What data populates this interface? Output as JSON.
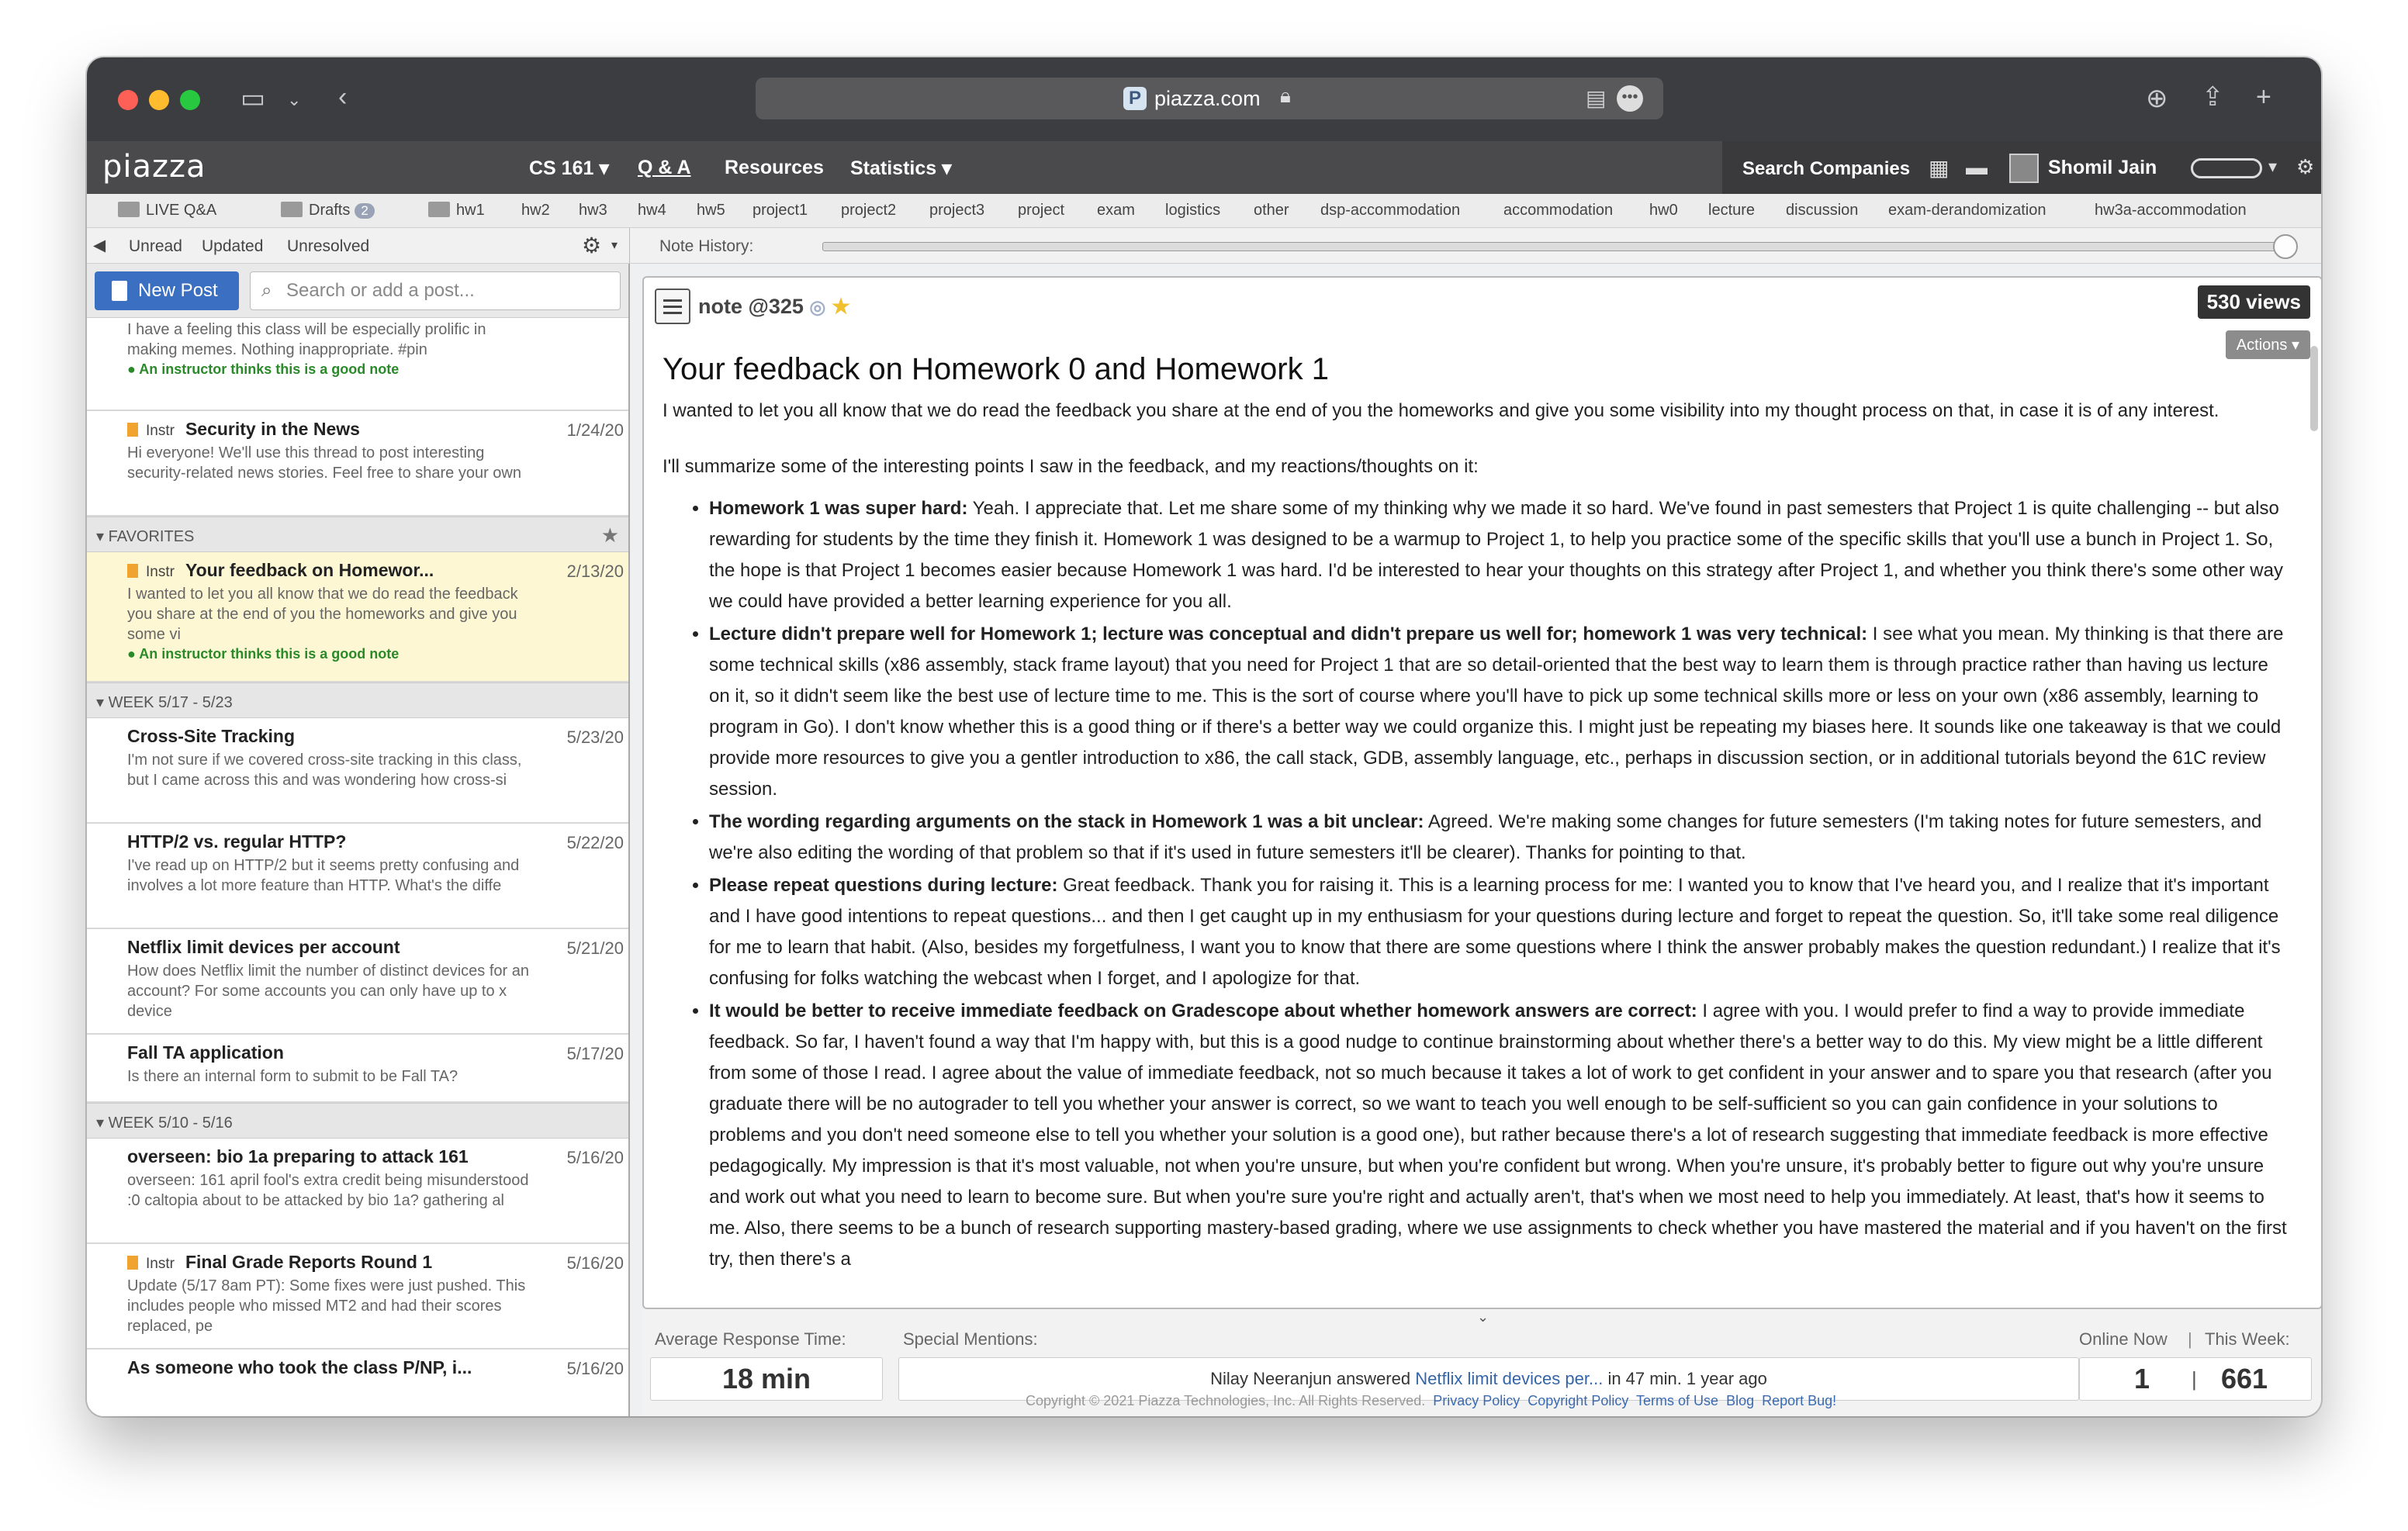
{
  "browser": {
    "host": "piazza.com"
  },
  "nav": {
    "logo": "piazza",
    "course": "CS 161 ▾",
    "qa": "Q & A",
    "resources": "Resources",
    "statistics": "Statistics ▾",
    "search_companies": "Search Companies",
    "user": "Shomil Jain"
  },
  "folders": {
    "live_qa": "LIVE Q&A",
    "drafts": "Drafts",
    "drafts_count": "2",
    "items": [
      "hw1",
      "hw2",
      "hw3",
      "hw4",
      "hw5",
      "project1",
      "project2",
      "project3",
      "project",
      "exam",
      "logistics",
      "other",
      "dsp-accommodation",
      "accommodation",
      "hw0",
      "lecture",
      "discussion",
      "exam-derandomization",
      "hw3a-accommodation"
    ]
  },
  "filters": {
    "unread": "Unread",
    "updated": "Updated",
    "unresolved": "Unresolved"
  },
  "history": {
    "label": "Note History:"
  },
  "sidebar": {
    "new_post": "New Post",
    "search_placeholder": "Search or add a post...",
    "first_snippet": "I have a feeling this class will be especially prolific in making memes. Nothing inappropriate. #pin",
    "good_note": "An instructor thinks this is a good note",
    "instr": "Instr",
    "security": {
      "title": "Security in the News",
      "date": "1/24/20",
      "snippet": "Hi everyone!  We'll use this thread to post interesting security-related news stories. Feel free to share your own"
    },
    "favorites_label": "FAVORITES",
    "feedback": {
      "title": "Your feedback on Homewor...",
      "date": "2/13/20",
      "snippet": "I wanted to let you all know that we do read the feedback you share at the end of you the homeworks and give you some vi"
    },
    "week1_label": "WEEK 5/17 - 5/23",
    "week1_items": [
      {
        "title": "Cross-Site Tracking",
        "date": "5/23/20",
        "snippet": "I'm not sure if we covered cross-site tracking in this class, but I came across this and was wondering how cross-si"
      },
      {
        "title": "HTTP/2 vs. regular HTTP?",
        "date": "5/22/20",
        "snippet": "I've read up on HTTP/2 but it seems pretty confusing and involves a lot more feature than HTTP. What's the diffe"
      },
      {
        "title": "Netflix limit devices per account",
        "date": "5/21/20",
        "snippet": "How does Netflix limit the number of distinct devices for an account? For some accounts you can only have up to x device"
      },
      {
        "title": "Fall TA application",
        "date": "5/17/20",
        "snippet": "Is there an internal form to submit to be Fall TA?"
      }
    ],
    "week2_label": "WEEK 5/10 - 5/16",
    "week2_items": [
      {
        "title": "overseen: bio 1a preparing to attack 161",
        "date": "5/16/20",
        "snippet": "overseen: 161 april fool's extra credit being misunderstood :0 caltopia about to be attacked by bio 1a? gathering al"
      },
      {
        "title": "Final Grade Reports Round 1",
        "date": "5/16/20",
        "snippet": "Update (5/17 8am PT): Some fixes were just pushed. This includes people who missed MT2 and had their scores replaced, pe"
      },
      {
        "title": "As someone who took the class P/NP, i...",
        "date": "5/16/20",
        "snippet": ""
      }
    ]
  },
  "post": {
    "label": "note @325",
    "views": "530 views",
    "actions": "Actions",
    "title": "Your feedback on Homework 0 and Homework 1",
    "intro": "I wanted to let you all know that we do read the feedback you share at the end of you the homeworks and give you some visibility into my thought process on that, in case it is of any interest.",
    "intro2": "I'll summarize some of the interesting points I saw in the feedback, and my reactions/thoughts on it:",
    "points": [
      {
        "bold": "Homework 1 was super hard:",
        "text": " Yeah.  I appreciate that.  Let me share some of my thinking why we made it so hard.  We've found in past semesters that Project 1 is quite challenging -- but also rewarding for students by the time they finish it.  Homework 1 was designed to be a warmup to Project 1, to help you practice some of the specific skills that you'll use a bunch in Project 1.  So, the hope is that Project 1 becomes easier because Homework 1 was hard.  I'd be interested to hear your thoughts on this strategy after Project 1, and whether you think there's some other way we could have provided a better learning experience for you all."
      },
      {
        "bold": "Lecture didn't prepare well for Homework 1; lecture was conceptual and didn't prepare us well for; homework 1 was very technical:",
        "text": " I see what you mean.  My thinking is that there are some technical skills (x86 assembly, stack frame layout) that you need for Project 1 that are so detail-oriented that the best way to learn them is through practice rather than having us lecture on it, so it didn't seem like the best use of lecture time to me.  This is the sort of course where you'll have to pick up some technical skills more or less on your own (x86 assembly, learning to program in Go).  I don't know whether this is a good thing or if there's a better way we could organize this.  I might just be repeating my biases here.  It sounds like one takeaway is that we could provide more resources to give you a gentler introduction to x86, the call stack, GDB, assembly language, etc., perhaps in discussion section, or in additional tutorials beyond the 61C review session."
      },
      {
        "bold": "The wording regarding arguments on the stack in Homework 1 was a bit unclear:",
        "text": " Agreed.  We're making some changes for future semesters (I'm taking notes for future semesters, and we're also editing the wording of that problem so that if it's used in future semesters it'll be clearer).  Thanks for pointing to that."
      },
      {
        "bold": "Please repeat questions during lecture:",
        "text": " Great feedback.  Thank you for raising it. This is a learning process for me: I wanted you to know that I've heard you, and I realize that it's important and I have good intentions to repeat questions... and then I get caught up in my enthusiasm for your questions during lecture and forget to repeat the question.  So, it'll take some real diligence for me to learn that habit.  (Also, besides my forgetfulness, I want you to know that there are some questions where I think the answer probably makes the question redundant.)   I realize that it's confusing for folks watching the webcast when I forget, and I apologize for that."
      },
      {
        "bold": "It would be better to receive immediate feedback on Gradescope about whether homework answers are correct:",
        "text": " I agree with you.  I would prefer to find a way to provide immediate feedback.  So far, I haven't found a way that I'm happy with, but this is a good nudge to continue brainstorming about whether there's a better way to do this.  My view might be a little different from some of those I read.  I agree about the value of immediate feedback, not so much because it takes a lot of work to get confident in your answer and to spare you that research (after you graduate there will be no autograder to tell you whether your answer is correct, so we want to teach you well enough to be self-sufficient so you can gain confidence in your solutions to problems and you don't need someone else to tell you whether your solution is a good one), but rather because there's a lot of research suggesting that immediate feedback is more effective pedagogically.  My impression is that it's most valuable, not when you're unsure, but when you're confident but wrong.  When you're unsure, it's probably better to figure out why you're unsure and work out what you need to learn to become sure.  But when you're sure you're right and actually aren't, that's when we most need to help you immediately.  At least, that's how it seems to me.  Also, there seems to be a bunch of research supporting mastery-based grading, where we use assignments to check whether you have mastered the material and if you haven't on the first try, then there's a"
      }
    ]
  },
  "footer": {
    "avg_label": "Average Response Time:",
    "avg_value": "18 min",
    "mentions_label": "Special Mentions:",
    "mention_name": "Nilay Neeranjun answered",
    "mention_link": "Netflix limit devices per...",
    "mention_tail": "in 47 min. 1 year ago",
    "online_label": "Online Now",
    "week_label": "This Week:",
    "online_value": "1",
    "week_value": "661",
    "copyright": "Copyright © 2021 Piazza Technologies, Inc. All Rights Reserved.",
    "links": [
      "Privacy Policy",
      "Copyright Policy",
      "Terms of Use",
      "Blog",
      "Report Bug!"
    ]
  },
  "colors": {
    "accent": "#3a6fc1",
    "selected": "#fdf7d4",
    "good": "#2a8a2a"
  }
}
